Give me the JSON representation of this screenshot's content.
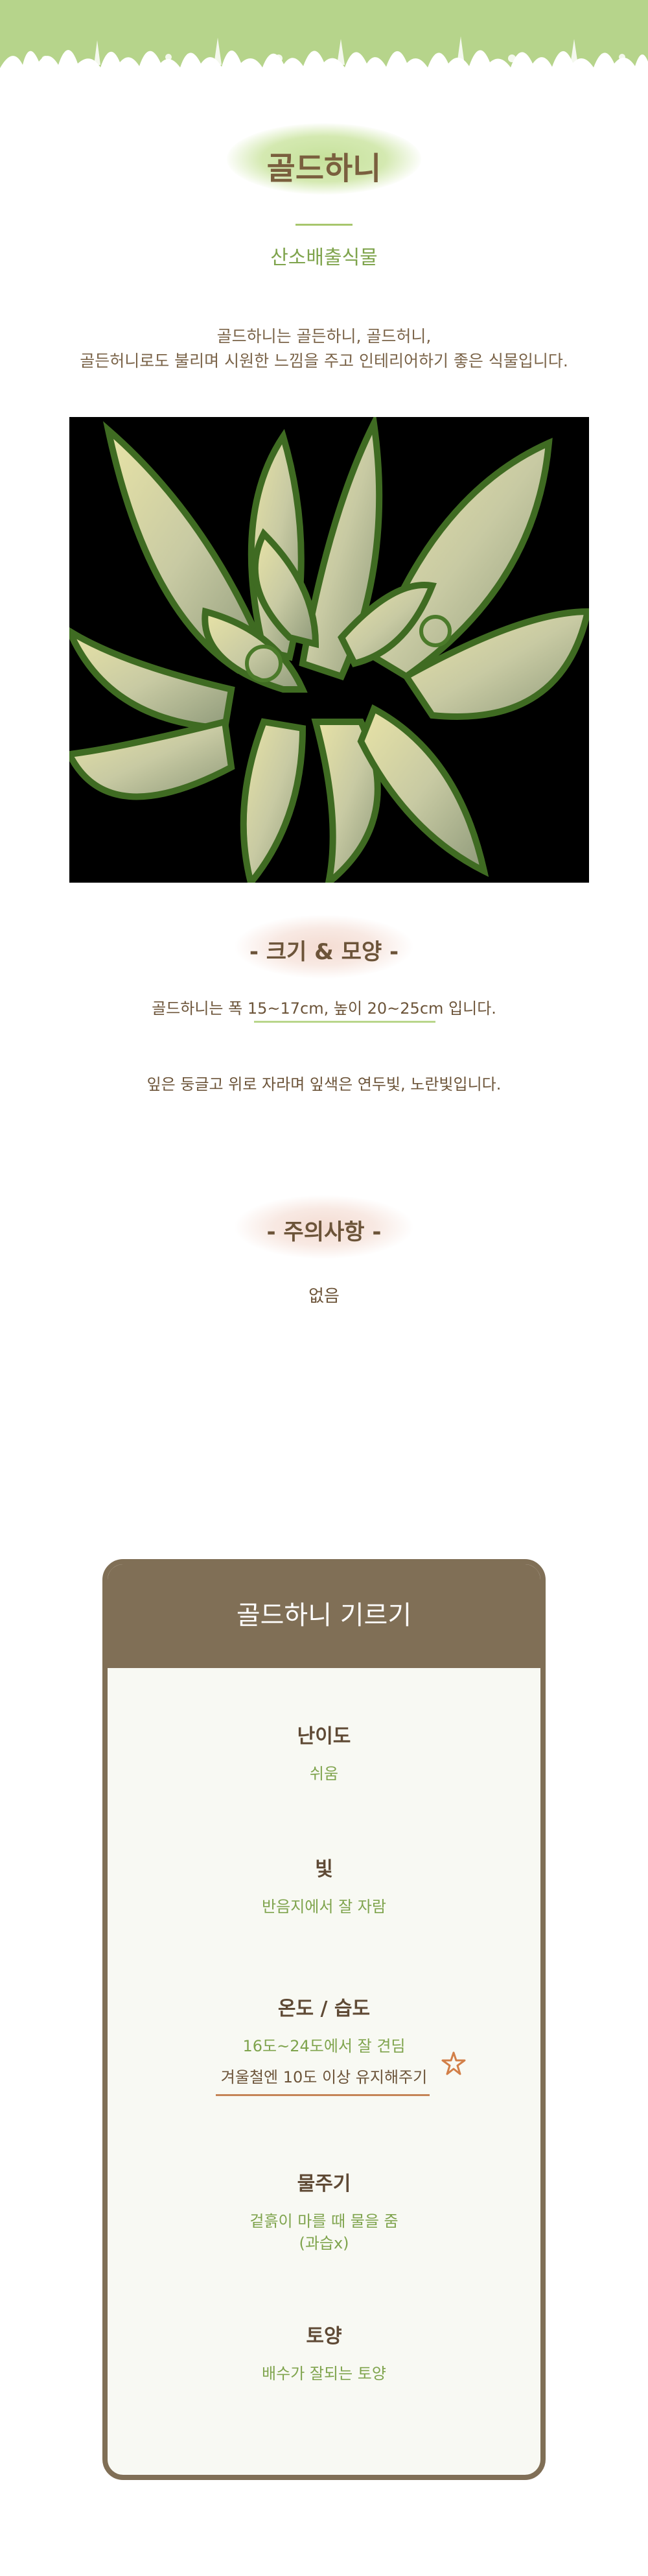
{
  "header": {
    "title": "골드하니",
    "subtitle": "산소배출식물",
    "intro_lines": [
      "골드하니는 골든하니, 골드허니,",
      "골든허니로도 불리며 시원한 느낌을 주고 인테리어하기 좋은 식물입니다."
    ]
  },
  "colors": {
    "banner": "#b6d48b",
    "accent_green": "#7fa44d",
    "brown": "#806f56",
    "text": "#6c5439"
  },
  "size_section": {
    "heading": "- 크기 & 모양 -",
    "line1": "골드하니는 폭 15~17cm, 높이 20~25cm 입니다.",
    "line2": "잎은 둥글고 위로 자라며 잎색은 연두빛, 노란빛입니다."
  },
  "caution_section": {
    "heading": "- 주의사항 -",
    "text": "없음"
  },
  "care_card": {
    "title": "골드하니 기르기",
    "items": [
      {
        "label": "난이도",
        "values": [
          "쉬움"
        ]
      },
      {
        "label": "빛",
        "values": [
          "반음지에서 잘 자람"
        ]
      },
      {
        "label": "온도 / 습도",
        "values": [
          "16도~24도에서 잘 견딤",
          "겨울철엔 10도 이상 유지해주기"
        ]
      },
      {
        "label": "물주기",
        "values": [
          "겉흙이 마를 때 물을 줌",
          "(과습x)"
        ]
      },
      {
        "label": "토양",
        "values": [
          "배수가 잘되는 토양"
        ]
      }
    ]
  }
}
